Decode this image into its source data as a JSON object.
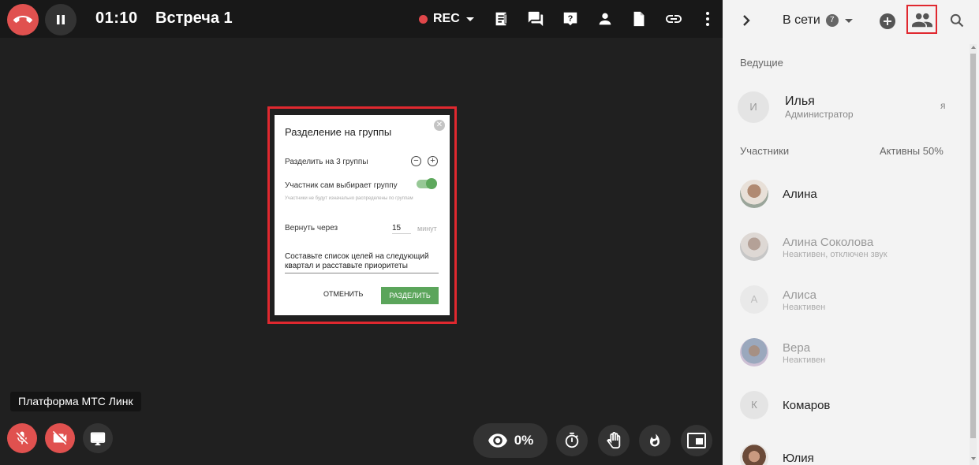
{
  "header": {
    "timer": "01:10",
    "meeting_title": "Встреча 1",
    "rec_label": "REC"
  },
  "toolbar": {
    "icons": [
      "end-call-icon",
      "pause-icon",
      "notes-icon",
      "chat-icon",
      "question-icon",
      "participant-icon",
      "document-icon",
      "link-icon",
      "more-vertical-icon"
    ]
  },
  "modal": {
    "title": "Разделение на группы",
    "split_label": "Разделить на 3 группы",
    "self_choose_label": "Участник сам выбирает группу",
    "self_choose_enabled": true,
    "hint": "Участники не будут изначально распределены по группам",
    "return_label": "Вернуть через",
    "return_value": "15",
    "return_unit": "минут",
    "task_text": "Составьте список целей на следующий квартал и расставьте приоритеты",
    "cancel_label": "ОТМЕНИТЬ",
    "split_button_label": "РАЗДЕЛИТЬ"
  },
  "bottom": {
    "tooltip": "Платформа МТС Линк",
    "viewers_value": "0%"
  },
  "colors": {
    "danger": "#e0514f",
    "accent_green": "#5ba55b",
    "highlight_frame": "#e0282f"
  },
  "panel": {
    "online_label": "В сети",
    "online_count": "7",
    "hosts_label": "Ведущие",
    "participants_label": "Участники",
    "active_label": "Активны 50%",
    "hosts": [
      {
        "initial": "И",
        "name": "Илья",
        "sub": "Администратор",
        "right": "я"
      }
    ],
    "participants": [
      {
        "name": "Алина",
        "sub": "",
        "photo": true
      },
      {
        "name": "Алина Соколова",
        "sub": "Неактивен, отключен звук",
        "photo": true
      },
      {
        "initial": "А",
        "name": "Алиса",
        "sub": "Неактивен"
      },
      {
        "name": "Вера",
        "sub": "Неактивен",
        "photo": true
      },
      {
        "initial": "К",
        "name": "Комаров",
        "sub": ""
      },
      {
        "name": "Юлия",
        "sub": "",
        "photo": true
      }
    ]
  }
}
